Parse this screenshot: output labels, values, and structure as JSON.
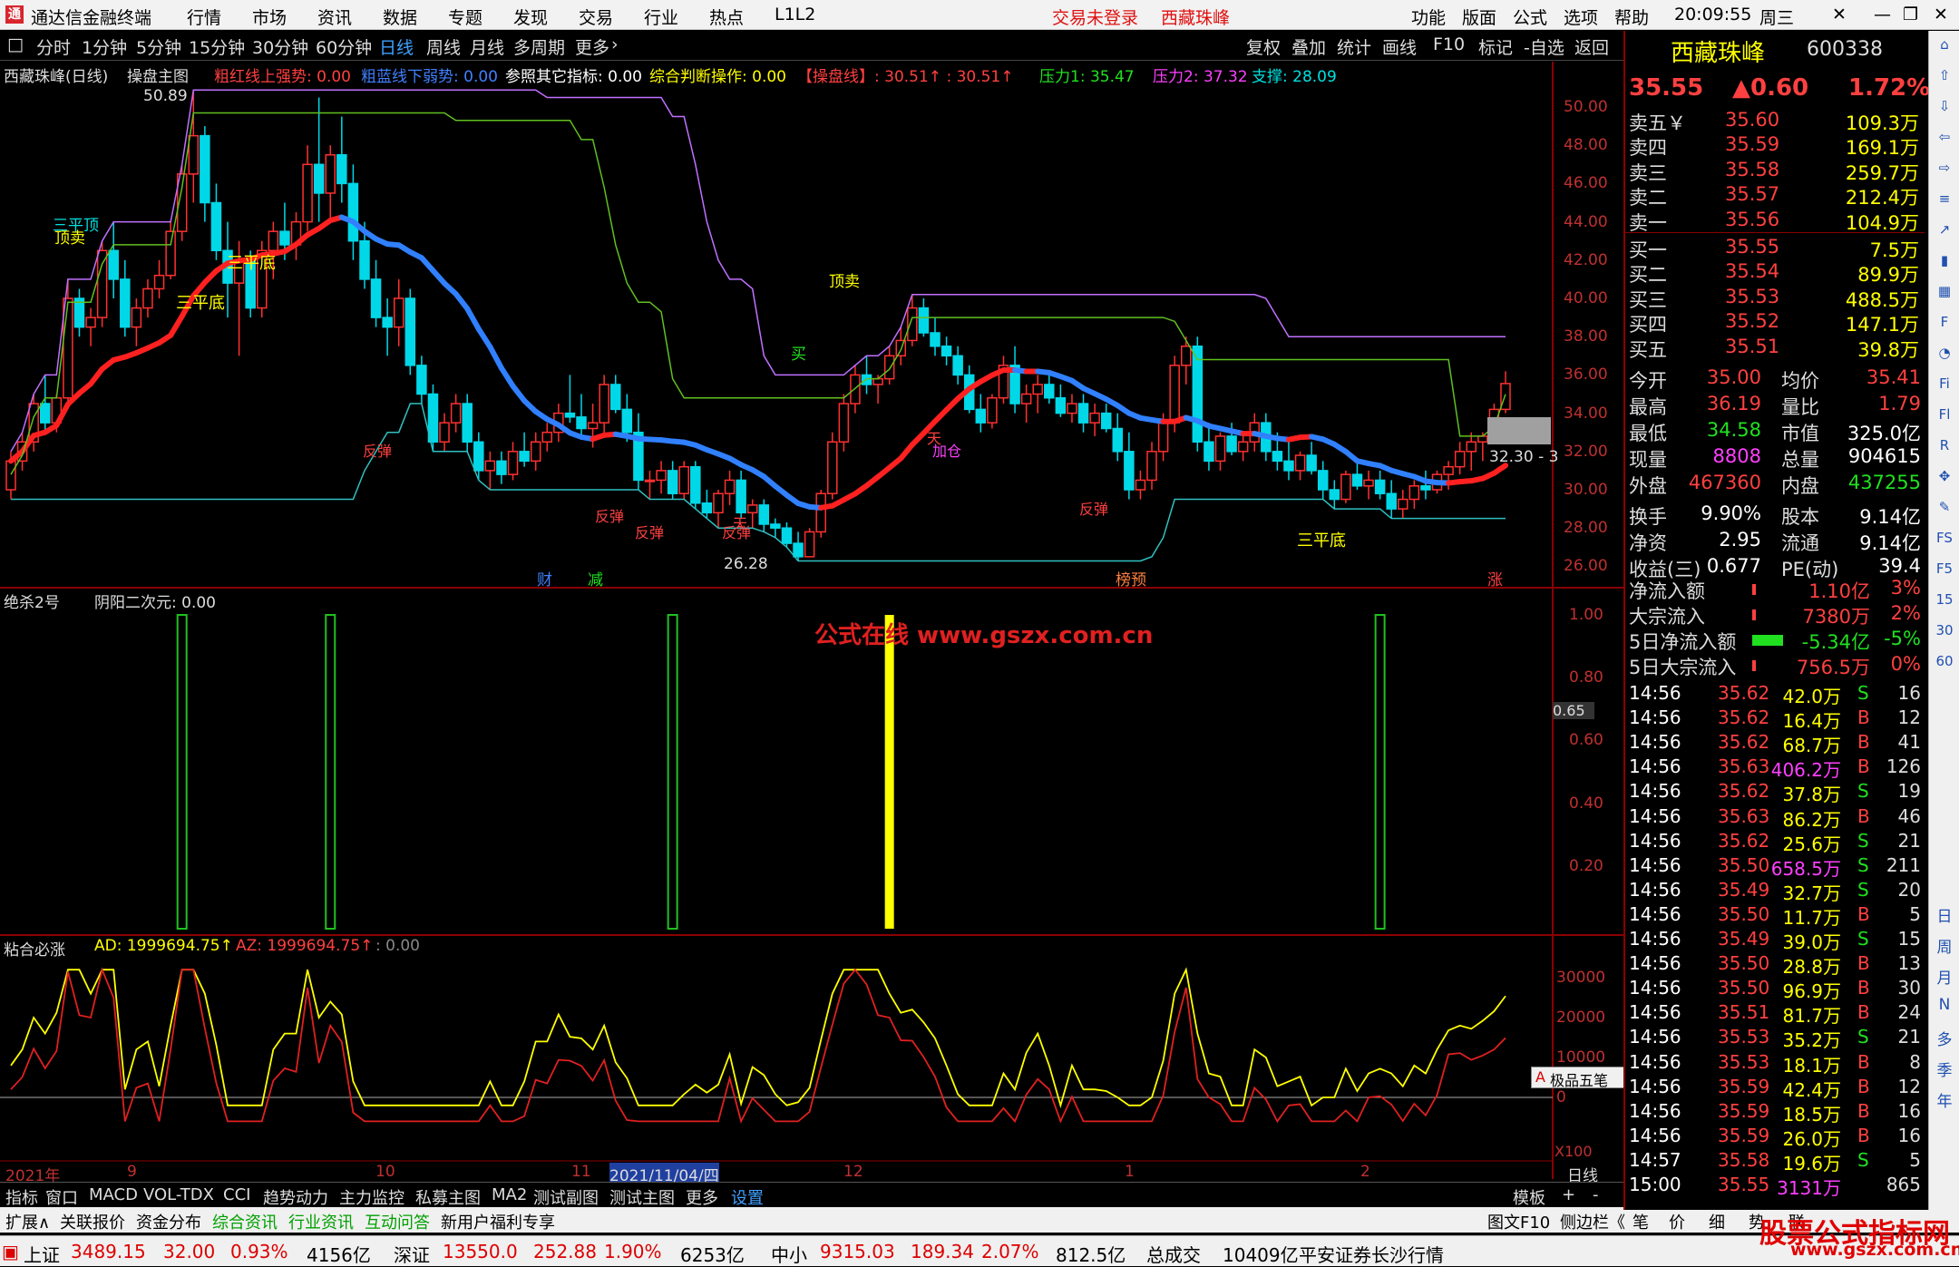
{
  "titlebar": {
    "app_name": "通达信金融终端",
    "menus": [
      "行情",
      "市场",
      "资讯",
      "数据",
      "专题",
      "发现",
      "交易",
      "行业",
      "热点",
      "L1L2"
    ],
    "login_status": "交易未登录",
    "stock_name": "西藏珠峰",
    "right_menus": [
      "功能",
      "版面",
      "公式",
      "选项",
      "帮助"
    ],
    "clock": "20:09:55",
    "weekday": "周三"
  },
  "toolbar": {
    "periods": [
      "分时",
      "1分钟",
      "5分钟",
      "15分钟",
      "30分钟",
      "60分钟",
      "日线",
      "周线",
      "月线",
      "多周期",
      "更多"
    ],
    "active_period": "日线",
    "right_buttons": [
      "复权",
      "叠加",
      "统计",
      "画线",
      "F10",
      "标记",
      "-自选",
      "返回"
    ]
  },
  "main_chart": {
    "title": "西藏珠峰(日线)",
    "indicator": "操盘主图",
    "legend": [
      {
        "text": "粗红线上强势: 0.00",
        "color": "#ff4040"
      },
      {
        "text": "粗蓝线下弱势: 0.00",
        "color": "#4080ff"
      },
      {
        "text": "参照其它指标: 0.00",
        "color": "#ffffff"
      },
      {
        "text": "综合判断操作: 0.00",
        "color": "#ffff00"
      },
      {
        "text": "【操盘线】: 30.51↑ : 30.51↑",
        "color": "#ff4040"
      },
      {
        "text": "压力1: 35.47",
        "color": "#20e020"
      },
      {
        "text": "压力2: 37.32",
        "color": "#ff40ff"
      },
      {
        "text": "支撑: 28.09",
        "color": "#00e0e0"
      }
    ],
    "y_ticks": [
      "50.00",
      "48.00",
      "46.00",
      "44.00",
      "42.00",
      "40.00",
      "38.00",
      "36.00",
      "34.00",
      "32.00",
      "30.00",
      "28.00",
      "26.00"
    ],
    "high_label": "50.89",
    "low_label": "26.28",
    "price_tag": "32.30 - 3",
    "annotations": [
      "顶卖",
      "三平顶",
      "三平底",
      "三平底",
      "顶卖",
      "买",
      "反弹",
      "反弹",
      "反弹",
      "反弹",
      "加仓",
      "反弹",
      "三平底",
      "天",
      "天"
    ],
    "bottom_markers": [
      {
        "text": "财",
        "color": "#4080ff"
      },
      {
        "text": "减",
        "color": "#20e020"
      },
      {
        "text": "榜预",
        "color": "#ff8040"
      },
      {
        "text": "涨",
        "color": "#ff4040"
      }
    ]
  },
  "sub_chart1": {
    "title": "绝杀2号",
    "legend": "阴阳二次元: 0.00",
    "y_ticks": [
      "1.00",
      "0.80",
      "0.60",
      "0.40",
      "0.20"
    ],
    "value_tag": "0.65",
    "watermark": "公式在线  www.gszx.com.cn"
  },
  "sub_chart2": {
    "title": "粘合必涨",
    "legend_ad": "AD: 1999694.75↑",
    "legend_az": "AZ: 1999694.75↑",
    "legend_zero": ": 0.00",
    "y_ticks": [
      "30000",
      "20000",
      "10000",
      "0"
    ],
    "x100": "X100",
    "tool_label": "极品五笔"
  },
  "x_axis": {
    "labels": [
      "2021年",
      "9",
      "10",
      "11",
      "2021/11/04/四",
      "12",
      "1",
      "2",
      "日线"
    ]
  },
  "bottom_tabs1": [
    "指标",
    "窗口",
    "MACD",
    "VOL-TDX",
    "CCI",
    "趋势动力",
    "主力监控",
    "私募主图",
    "MA2",
    "测试副图",
    "测试主图",
    "更多",
    "设置"
  ],
  "bottom_tabs1_right": [
    "模板",
    "+",
    "-"
  ],
  "bottom_tabs2": [
    "扩展∧",
    "关联报价",
    "资金分布",
    "综合资讯",
    "行业资讯",
    "互动问答",
    "新用户福利专享"
  ],
  "bottom_tabs2_right": [
    "图文F10",
    "侧边栏《",
    "笔",
    "价",
    "细",
    "势",
    "联"
  ],
  "quote": {
    "name": "西藏珠峰",
    "code": "600338",
    "price": "35.55",
    "change": "▲0.60",
    "pct": "1.72%",
    "asks": [
      {
        "label": "卖五￥",
        "price": "35.60",
        "vol": "109.3万"
      },
      {
        "label": "卖四",
        "price": "35.59",
        "vol": "169.1万"
      },
      {
        "label": "卖三",
        "price": "35.58",
        "vol": "259.7万"
      },
      {
        "label": "卖二",
        "price": "35.57",
        "vol": "212.4万"
      },
      {
        "label": "卖一",
        "price": "35.56",
        "vol": "104.9万"
      }
    ],
    "bids": [
      {
        "label": "买一",
        "price": "35.55",
        "vol": "7.5万"
      },
      {
        "label": "买二",
        "price": "35.54",
        "vol": "89.9万"
      },
      {
        "label": "买三",
        "price": "35.53",
        "vol": "488.5万"
      },
      {
        "label": "买四",
        "price": "35.52",
        "vol": "147.1万"
      },
      {
        "label": "买五",
        "price": "35.51",
        "vol": "39.8万"
      }
    ],
    "stats": [
      {
        "k1": "今开",
        "v1": "35.00",
        "k2": "均价",
        "v2": "35.41",
        "c1": "red",
        "c2": "red"
      },
      {
        "k1": "最高",
        "v1": "36.19",
        "k2": "量比",
        "v2": "1.79",
        "c1": "red",
        "c2": "red"
      },
      {
        "k1": "最低",
        "v1": "34.58",
        "k2": "市值",
        "v2": "325.0亿",
        "c1": "green",
        "c2": "white"
      },
      {
        "k1": "现量",
        "v1": "8808",
        "k2": "总量",
        "v2": "904615",
        "c1": "mag",
        "c2": "white"
      },
      {
        "k1": "外盘",
        "v1": "467360",
        "k2": "内盘",
        "v2": "437255",
        "c1": "red",
        "c2": "green"
      }
    ],
    "stats2": [
      {
        "k1": "换手",
        "v1": "9.90%",
        "k2": "股本",
        "v2": "9.14亿"
      },
      {
        "k1": "净资",
        "v1": "2.95",
        "k2": "流通",
        "v2": "9.14亿"
      },
      {
        "k1": "收益(三)",
        "v1": "0.677",
        "k2": "PE(动)",
        "v2": "39.4"
      }
    ],
    "flows": [
      {
        "k": "净流入额",
        "v": "1.10亿",
        "p": "3%",
        "c": "red"
      },
      {
        "k": "大宗流入",
        "v": "7380万",
        "p": "2%",
        "c": "red"
      },
      {
        "k": "5日净流入额",
        "v": "-5.34亿",
        "p": "-5%",
        "c": "green"
      },
      {
        "k": "5日大宗流入",
        "v": "756.5万",
        "p": "0%",
        "c": "red"
      }
    ],
    "ticks": [
      {
        "t": "14:56",
        "p": "35.62",
        "v": "42.0万",
        "s": "S",
        "n": "16"
      },
      {
        "t": "14:56",
        "p": "35.62",
        "v": "16.4万",
        "s": "B",
        "n": "12"
      },
      {
        "t": "14:56",
        "p": "35.62",
        "v": "68.7万",
        "s": "B",
        "n": "41"
      },
      {
        "t": "14:56",
        "p": "35.63",
        "v": "406.2万",
        "s": "B",
        "n": "126"
      },
      {
        "t": "14:56",
        "p": "35.62",
        "v": "37.8万",
        "s": "S",
        "n": "19"
      },
      {
        "t": "14:56",
        "p": "35.63",
        "v": "86.2万",
        "s": "B",
        "n": "46"
      },
      {
        "t": "14:56",
        "p": "35.62",
        "v": "25.6万",
        "s": "S",
        "n": "21"
      },
      {
        "t": "14:56",
        "p": "35.50",
        "v": "658.5万",
        "s": "S",
        "n": "211"
      },
      {
        "t": "14:56",
        "p": "35.49",
        "v": "32.7万",
        "s": "S",
        "n": "20"
      },
      {
        "t": "14:56",
        "p": "35.50",
        "v": "11.7万",
        "s": "B",
        "n": "5"
      },
      {
        "t": "14:56",
        "p": "35.49",
        "v": "39.0万",
        "s": "S",
        "n": "15"
      },
      {
        "t": "14:56",
        "p": "35.50",
        "v": "28.8万",
        "s": "B",
        "n": "13"
      },
      {
        "t": "14:56",
        "p": "35.50",
        "v": "96.9万",
        "s": "B",
        "n": "30"
      },
      {
        "t": "14:56",
        "p": "35.51",
        "v": "81.7万",
        "s": "B",
        "n": "24"
      },
      {
        "t": "14:56",
        "p": "35.53",
        "v": "35.2万",
        "s": "S",
        "n": "21"
      },
      {
        "t": "14:56",
        "p": "35.53",
        "v": "18.1万",
        "s": "B",
        "n": "8"
      },
      {
        "t": "14:56",
        "p": "35.59",
        "v": "42.4万",
        "s": "B",
        "n": "12"
      },
      {
        "t": "14:56",
        "p": "35.59",
        "v": "18.5万",
        "s": "B",
        "n": "16"
      },
      {
        "t": "14:56",
        "p": "35.59",
        "v": "26.0万",
        "s": "B",
        "n": "16"
      },
      {
        "t": "14:57",
        "p": "35.58",
        "v": "19.6万",
        "s": "S",
        "n": "5"
      },
      {
        "t": "15:00",
        "p": "35.55",
        "v": "3131万",
        "s": "",
        "n": "865"
      }
    ]
  },
  "sidebar_icons": [
    "hat-icon",
    "up-arrow-icon",
    "down-arrow-icon",
    "left-arrow-icon",
    "right-arrow-icon",
    "list-icon",
    "chart-icon",
    "bar-icon",
    "grid-icon",
    "f10-icon",
    "pie-icon",
    "fi-icon",
    "fl-icon",
    "rsi-icon",
    "move-icon",
    "pen-icon",
    "fs-icon",
    "f5-icon",
    "n15-icon",
    "n30-icon",
    "n60-icon"
  ],
  "sidebar_labels": [
    "日",
    "周",
    "月",
    "N",
    "多",
    "季",
    "年"
  ],
  "statusbar": {
    "sh": {
      "name": "上证",
      "v": "3489.15",
      "chg": "32.00",
      "pct": "0.93%",
      "amt": "4156亿"
    },
    "sz": {
      "name": "深证",
      "v": "13550.0",
      "chg": "252.88",
      "pct": "1.90%",
      "amt": "6253亿"
    },
    "zx": {
      "name": "中小",
      "v": "9315.03",
      "chg": "189.34",
      "pct": "2.07%",
      "amt": "812.5亿"
    },
    "total_label": "总成交",
    "total": "10409亿",
    "broker": "平安证券长沙行情",
    "brand": "股票公式指标网",
    "brand_url": "www.gszx.com.cn"
  },
  "chart_data": {
    "type": "candlestick",
    "ylim": [
      25,
      51
    ],
    "candles": [
      [
        30,
        32,
        29.5,
        31.5
      ],
      [
        31.5,
        33,
        31,
        32.5
      ],
      [
        32.5,
        35,
        32,
        34.5
      ],
      [
        34.5,
        36,
        33,
        33.5
      ],
      [
        33.5,
        35,
        33,
        34.8
      ],
      [
        34.8,
        41,
        34.5,
        40
      ],
      [
        40,
        40.5,
        38,
        38.5
      ],
      [
        38.5,
        39.5,
        37.5,
        39
      ],
      [
        39,
        43,
        38.5,
        42.5
      ],
      [
        42.5,
        44,
        40,
        41
      ],
      [
        41,
        42,
        38,
        38.5
      ],
      [
        38.5,
        40,
        37.5,
        39.5
      ],
      [
        39.5,
        41,
        39,
        40.5
      ],
      [
        40.5,
        42,
        40,
        41.2
      ],
      [
        41.2,
        44,
        41,
        43.5
      ],
      [
        43.5,
        47,
        43,
        46.5
      ],
      [
        46.5,
        50.89,
        45,
        48.5
      ],
      [
        48.5,
        49,
        44,
        45
      ],
      [
        45,
        46,
        42,
        42.5
      ],
      [
        42.5,
        44,
        39,
        40.8
      ],
      [
        40.8,
        43,
        37,
        42
      ],
      [
        42,
        42.5,
        39,
        39.5
      ],
      [
        39.5,
        43,
        39,
        42.5
      ],
      [
        42.5,
        44,
        41,
        43.5
      ],
      [
        43.5,
        45,
        42,
        42.8
      ],
      [
        42.8,
        44.5,
        42,
        44
      ],
      [
        44,
        48,
        43.5,
        47
      ],
      [
        47,
        50.5,
        44,
        45.5
      ],
      [
        45.5,
        48,
        44,
        47.5
      ],
      [
        47.5,
        49.5,
        45,
        46
      ],
      [
        46,
        47,
        42,
        43
      ],
      [
        43,
        44,
        40.5,
        41
      ],
      [
        41,
        42,
        38.5,
        39
      ],
      [
        39,
        40,
        37,
        38.5
      ],
      [
        38.5,
        41,
        37.5,
        40
      ],
      [
        40,
        40.5,
        36,
        36.5
      ],
      [
        36.5,
        37,
        34.5,
        35
      ],
      [
        35,
        35.5,
        32,
        32.5
      ],
      [
        32.5,
        34,
        32,
        33.5
      ],
      [
        33.5,
        35,
        33,
        34.5
      ],
      [
        34.5,
        35,
        32,
        32.5
      ],
      [
        32.5,
        33,
        30.5,
        31
      ],
      [
        31,
        32,
        30,
        31.5
      ],
      [
        31.5,
        32,
        30.3,
        30.8
      ],
      [
        30.8,
        32.5,
        30.5,
        32
      ],
      [
        32,
        33,
        31.2,
        31.5
      ],
      [
        31.5,
        33,
        31,
        32.5
      ],
      [
        32.5,
        33.5,
        32,
        33
      ],
      [
        33,
        34.5,
        32.5,
        34
      ],
      [
        34,
        36,
        33.5,
        33.8
      ],
      [
        33.8,
        35,
        32.8,
        33.2
      ],
      [
        33.2,
        34.5,
        32.2,
        33.5
      ],
      [
        33.5,
        36,
        33,
        35.5
      ],
      [
        35.5,
        36,
        34,
        34.2
      ],
      [
        34.2,
        35,
        32.5,
        33
      ],
      [
        33,
        34,
        30,
        30.5
      ],
      [
        30.5,
        31,
        29.5,
        30.5
      ],
      [
        30.5,
        31.5,
        29.8,
        31
      ],
      [
        31,
        31.5,
        29.5,
        29.8
      ],
      [
        29.8,
        31.5,
        29.5,
        31.2
      ],
      [
        31.2,
        31.5,
        29,
        29.3
      ],
      [
        29.3,
        30,
        28.5,
        28.8
      ],
      [
        28.8,
        30,
        28,
        29.8
      ],
      [
        29.8,
        31,
        29.2,
        30.5
      ],
      [
        30.5,
        31,
        28.5,
        28.8
      ],
      [
        28.8,
        29.5,
        28,
        29.2
      ],
      [
        29.2,
        29.5,
        27.8,
        28.2
      ],
      [
        28.2,
        28.5,
        27.5,
        28
      ],
      [
        28,
        28.3,
        27,
        27.2
      ],
      [
        27.2,
        27.8,
        26.28,
        26.5
      ],
      [
        26.5,
        28,
        26.5,
        27.8
      ],
      [
        27.8,
        30,
        27.5,
        29.8
      ],
      [
        29.8,
        33,
        29.5,
        32.5
      ],
      [
        32.5,
        35,
        32,
        34.5
      ],
      [
        34.5,
        36.5,
        34,
        36
      ],
      [
        36,
        37,
        35,
        35.5
      ],
      [
        35.5,
        36,
        34.5,
        35.8
      ],
      [
        35.8,
        37.5,
        35.5,
        37
      ],
      [
        37,
        38.5,
        36.5,
        37.8
      ],
      [
        37.8,
        40.2,
        37.5,
        39.5
      ],
      [
        39.5,
        40,
        38,
        38.2
      ],
      [
        38.2,
        39,
        37,
        37.5
      ],
      [
        37.5,
        38,
        36.5,
        37
      ],
      [
        37,
        37.5,
        35.5,
        36
      ],
      [
        36,
        36.5,
        34,
        34.2
      ],
      [
        34.2,
        35,
        33,
        33.5
      ],
      [
        33.5,
        35,
        33.2,
        34.8
      ],
      [
        34.8,
        37,
        34.5,
        36.5
      ],
      [
        36.5,
        37.5,
        34,
        34.5
      ],
      [
        34.5,
        35.5,
        33.5,
        35
      ],
      [
        35,
        36,
        34,
        35.5
      ],
      [
        35.5,
        36,
        34.5,
        34.8
      ],
      [
        34.8,
        35.5,
        33.8,
        34
      ],
      [
        34,
        35,
        33.5,
        34.5
      ],
      [
        34.5,
        35,
        33,
        33.5
      ],
      [
        33.5,
        34.5,
        32.8,
        34
      ],
      [
        34,
        34.5,
        33,
        33.2
      ],
      [
        33.2,
        34,
        31.5,
        32
      ],
      [
        32,
        33,
        29.5,
        30
      ],
      [
        30,
        31,
        29.5,
        30.5
      ],
      [
        30.5,
        32.5,
        30,
        32
      ],
      [
        32,
        34,
        31.5,
        33.5
      ],
      [
        33.5,
        37,
        33,
        36.5
      ],
      [
        36.5,
        38,
        35.5,
        37.5
      ],
      [
        37.5,
        38,
        32,
        32.5
      ],
      [
        32.5,
        33.5,
        31,
        31.5
      ],
      [
        31.5,
        33,
        31,
        32.8
      ],
      [
        32.8,
        33.5,
        31.8,
        32
      ],
      [
        32,
        33,
        31.5,
        32.5
      ],
      [
        32.5,
        34,
        32,
        33.5
      ],
      [
        33.5,
        34,
        31.5,
        32
      ],
      [
        32,
        33,
        31,
        31.5
      ],
      [
        31.5,
        32.5,
        30.5,
        31
      ],
      [
        31,
        32,
        30.5,
        31.8
      ],
      [
        31.8,
        32.5,
        30.8,
        31
      ],
      [
        31,
        31.5,
        29.5,
        30
      ],
      [
        30,
        30.5,
        29,
        29.5
      ],
      [
        29.5,
        31,
        29.3,
        30.8
      ],
      [
        30.8,
        31.5,
        30,
        30.2
      ],
      [
        30.2,
        31,
        29.5,
        30.5
      ],
      [
        30.5,
        31,
        29.5,
        29.8
      ],
      [
        29.8,
        30.5,
        28.5,
        29
      ],
      [
        29,
        30,
        28.5,
        29.5
      ],
      [
        29.5,
        30.5,
        29,
        30.2
      ],
      [
        30.2,
        31,
        29.5,
        30
      ],
      [
        30,
        31,
        29.8,
        30.8
      ],
      [
        30.8,
        31.5,
        30,
        31.2
      ],
      [
        31.2,
        32.5,
        30.8,
        32
      ],
      [
        32,
        33,
        31,
        32.5
      ],
      [
        32.5,
        33,
        31.5,
        32.8
      ],
      [
        32.8,
        34.5,
        32.5,
        34.2
      ],
      [
        34.2,
        36.19,
        34,
        35.55
      ]
    ]
  }
}
